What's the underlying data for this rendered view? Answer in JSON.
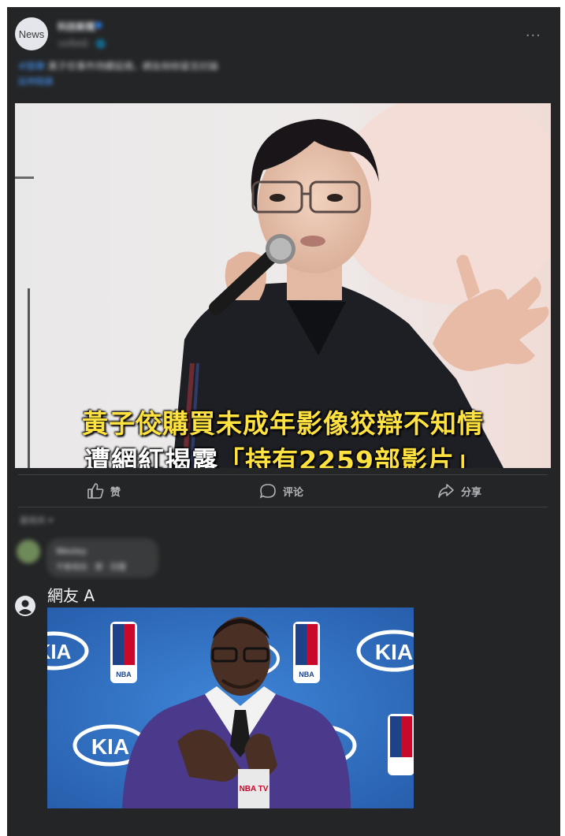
{
  "post": {
    "avatar_label": "News",
    "page_name": "科技新聞",
    "meta": "10月8日 · 🌐",
    "text_tag": "#娛樂",
    "text": "黃子佼事件持續延燒，網友紛紛留言討論",
    "sub_link": "延伸閱讀",
    "more_label": "···"
  },
  "media": {
    "caption_line1": "黃子佼購買未成年影像狡辯不知情",
    "caption_line2_prefix": "遭網紅揭露",
    "caption_line2_quote": "「持有2259部影片」"
  },
  "actions": {
    "like": "赞",
    "comment": "评论",
    "share": "分享"
  },
  "comments": {
    "sort_label": "最相关 ▾",
    "first": {
      "name": "Wesley",
      "body": "不敢相信 · 贊 · 回覆"
    },
    "second": {
      "name": "網友 A",
      "meme": {
        "sponsor_left": "KIA",
        "sponsor_mid": "KIA",
        "sponsor_right": "KIA",
        "league": "NBA",
        "mic_logo": "NBA TV"
      }
    }
  },
  "colors": {
    "card_bg": "#242526",
    "caption_yellow": "#ffe23f",
    "link_blue": "#4599ff"
  }
}
